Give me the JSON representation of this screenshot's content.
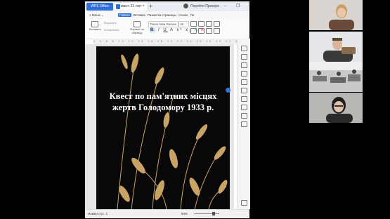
{
  "window": {
    "app_tab": "WPS Office",
    "doc_tab": "квест 21 лют",
    "new_tab": "+",
    "signin": "Перейти Преміум",
    "controls": "– ❐ ✕"
  },
  "menu": {
    "menu_button": "≡ Меню ⌄",
    "ribbon_tabs": [
      "Главна",
      "Вставка",
      "Разметка страницы",
      "Ссылк",
      "Пе"
    ],
    "active_tab": "Главна"
  },
  "toolbar": {
    "paste": "Вставить",
    "cut": "Вырезать",
    "copy": "Копировать",
    "format_painter": "Формат по образцу",
    "font_name": "Times New Roman",
    "font_size": "16",
    "format_buttons": [
      "B",
      "I",
      "U",
      "A",
      "x²",
      "x₂",
      "A",
      "A"
    ]
  },
  "ruler": "2 4 6 8 10 12 14 16 18 20 22 24 26 28 30 32 34 36",
  "document": {
    "title_line1": "Квест по пам'ятних місцях",
    "title_line2": "жертв Голодомору 1933 р."
  },
  "status": {
    "page_count": "Номер стр.: 1",
    "zoom": "94%"
  },
  "colors": {
    "accent": "#2e6fd9",
    "page_bg": "#080808",
    "wheat": "#c8a365"
  }
}
